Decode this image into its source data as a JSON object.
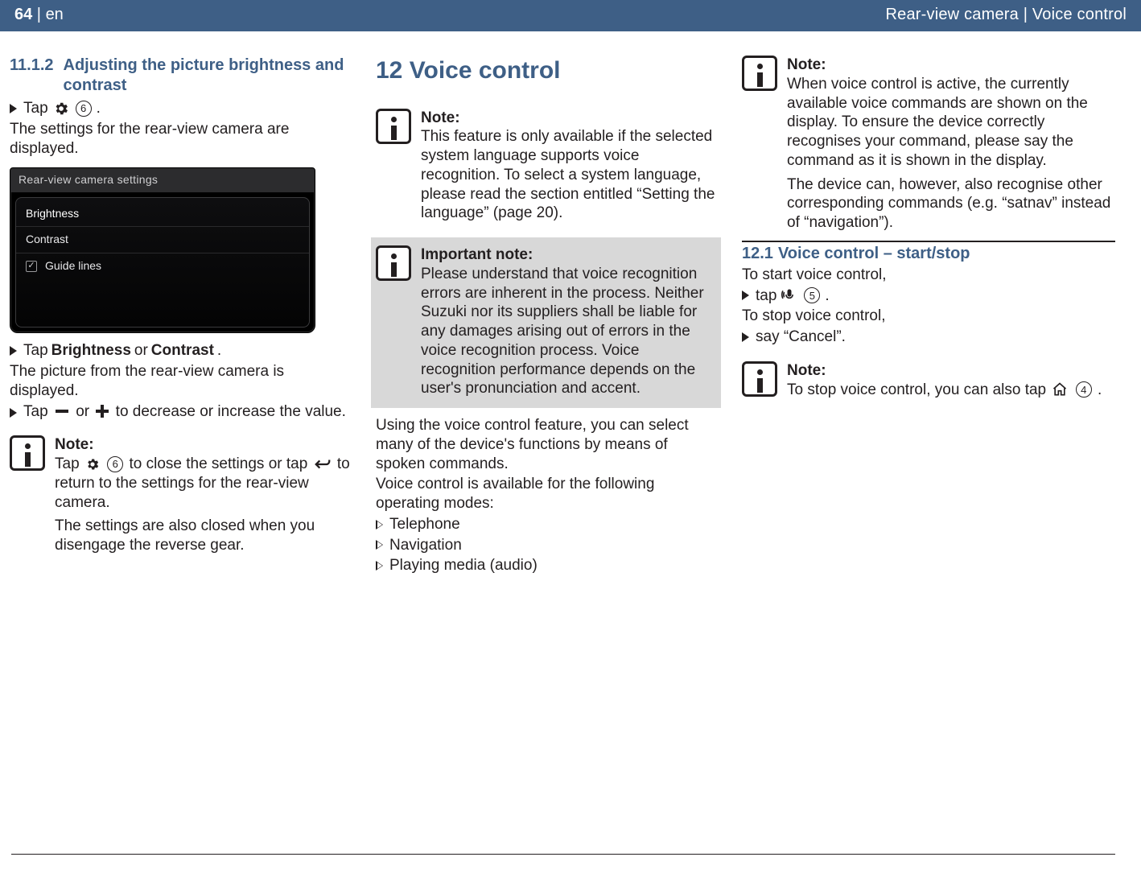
{
  "header": {
    "page_no": "64",
    "lang_sep": " | ",
    "lang": "en",
    "right": "Rear-view camera | Voice control"
  },
  "col1": {
    "h_no": "11.1.2",
    "h_txt": "Adjusting the picture brightness and contrast",
    "step1_a": "Tap ",
    "step1_b": ".",
    "circle6": "6",
    "after1": "The settings for the rear-view camera are displayed.",
    "shot": {
      "title": "Rear-view camera settings",
      "rows": [
        "Brightness",
        "Contrast",
        "Guide lines"
      ]
    },
    "step2_a": "Tap ",
    "step2_b": "Brightness",
    "step2_c": " or ",
    "step2_d": "Contrast",
    "step2_e": ".",
    "after2": "The picture from the rear-view camera is displayed.",
    "step3_a": "Tap ",
    "step3_b": " or ",
    "step3_c": " to decrease or increase the value.",
    "note": {
      "title": "Note:",
      "l1a": "Tap ",
      "l1b": " to close the settings or tap ",
      "l1c": " to return to the settings for the rear-view camera.",
      "l2": "The settings are also closed when you disengage the reverse gear."
    }
  },
  "col2": {
    "h": "12 Voice control",
    "note1": {
      "title": "Note:",
      "body": "This feature is only available if the selected system language supports voice recognition. To select a system language, please read the section entitled “Setting the language” (page 20)."
    },
    "note2": {
      "title": "Important note:",
      "body": "Please understand that voice recognition errors are inherent in the process. Neither Suzuki nor its suppliers shall be liable for any damages arising out of errors in the voice recognition process. Voice recognition performance depends on the user's pronunciation and accent."
    },
    "p1": "Using the voice control feature, you can select many of the device's functions by means of spoken commands.",
    "p2": "Voice control is available for the following operating modes:",
    "modes": [
      "Telephone",
      "Navigation",
      "Playing media (audio)"
    ]
  },
  "col3": {
    "note1": {
      "title": "Note:",
      "b1": "When voice control is active, the currently available voice commands are shown on the display. To ensure the device correctly recognises your command, please say the command as it is shown in the display.",
      "b2": "The device can, however, also recognise other corresponding commands (e.g. “satnav” instead of “navigation”)."
    },
    "sub_no": "12.1",
    "sub_txt": "Voice control – start/stop",
    "start_intro": "To start voice control,",
    "start_step_a": "tap ",
    "start_step_b": ".",
    "circle5": "5",
    "stop_intro": "To stop voice control,",
    "stop_step": "say “Cancel”.",
    "note2": {
      "title": "Note:",
      "a": "To stop voice control, you can also tap ",
      "b": ".",
      "circle4": "4"
    }
  }
}
